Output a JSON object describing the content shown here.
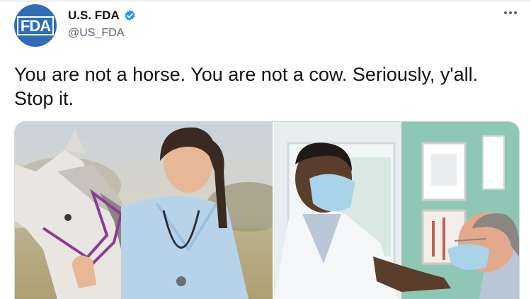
{
  "account": {
    "display_name": "U.S. FDA",
    "handle": "@US_FDA",
    "avatar_logo_text": "FDA",
    "verified": true
  },
  "tweet": {
    "text": "You are not a horse. You are not a cow. Seriously, y'all. Stop it."
  },
  "media": {
    "photos": [
      {
        "subject": "veterinarian-with-horse"
      },
      {
        "subject": "doctor-examining-patient"
      }
    ]
  },
  "icons": {
    "more": "more-horizontal-icon",
    "verified": "verified-badge-icon"
  },
  "colors": {
    "brand_blue": "#2f6db5",
    "verified_blue": "#1d9bf0",
    "text": "#0f1419",
    "secondary_text": "#536471"
  }
}
